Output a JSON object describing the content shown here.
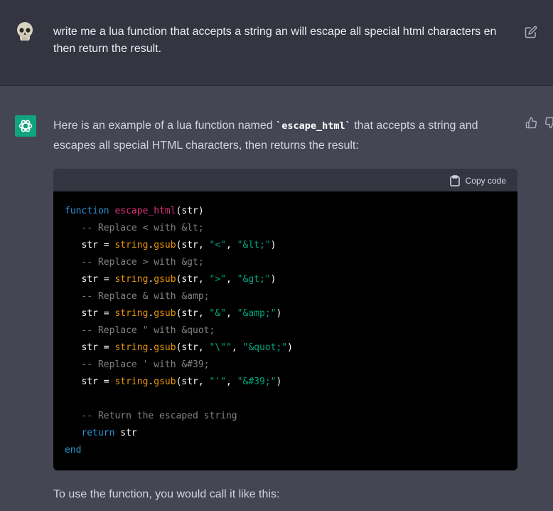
{
  "user_message": {
    "avatar_icon": "skull-icon",
    "text": "write me a lua function that accepts a string an will escape all special html characters en then return the result.",
    "edit_icon": "edit-icon"
  },
  "assistant_message": {
    "avatar_icon": "openai-logo-icon",
    "intro_before": "Here is an example of a lua function named ",
    "intro_code": "`escape_html`",
    "intro_after": " that accepts a string and escapes all special HTML characters, then returns the result:",
    "thumbs_up_icon": "thumbs-up-icon",
    "thumbs_down_icon": "thumbs-down-icon",
    "code_block": {
      "copy_label": "Copy code",
      "lines": [
        [
          {
            "t": "k",
            "v": "function"
          },
          {
            "t": "p",
            "v": " "
          },
          {
            "t": "f",
            "v": "escape_html"
          },
          {
            "t": "p",
            "v": "(str)"
          }
        ],
        [
          {
            "t": "c",
            "v": "   -- Replace < with &lt;"
          }
        ],
        [
          {
            "t": "p",
            "v": "   str = "
          },
          {
            "t": "b",
            "v": "string"
          },
          {
            "t": "p",
            "v": "."
          },
          {
            "t": "b",
            "v": "gsub"
          },
          {
            "t": "p",
            "v": "(str, "
          },
          {
            "t": "s",
            "v": "\"<\""
          },
          {
            "t": "p",
            "v": ", "
          },
          {
            "t": "s",
            "v": "\"&lt;\""
          },
          {
            "t": "p",
            "v": ")"
          }
        ],
        [
          {
            "t": "c",
            "v": "   -- Replace > with &gt;"
          }
        ],
        [
          {
            "t": "p",
            "v": "   str = "
          },
          {
            "t": "b",
            "v": "string"
          },
          {
            "t": "p",
            "v": "."
          },
          {
            "t": "b",
            "v": "gsub"
          },
          {
            "t": "p",
            "v": "(str, "
          },
          {
            "t": "s",
            "v": "\">\""
          },
          {
            "t": "p",
            "v": ", "
          },
          {
            "t": "s",
            "v": "\"&gt;\""
          },
          {
            "t": "p",
            "v": ")"
          }
        ],
        [
          {
            "t": "c",
            "v": "   -- Replace & with &amp;"
          }
        ],
        [
          {
            "t": "p",
            "v": "   str = "
          },
          {
            "t": "b",
            "v": "string"
          },
          {
            "t": "p",
            "v": "."
          },
          {
            "t": "b",
            "v": "gsub"
          },
          {
            "t": "p",
            "v": "(str, "
          },
          {
            "t": "s",
            "v": "\"&\""
          },
          {
            "t": "p",
            "v": ", "
          },
          {
            "t": "s",
            "v": "\"&amp;\""
          },
          {
            "t": "p",
            "v": ")"
          }
        ],
        [
          {
            "t": "c",
            "v": "   -- Replace \" with &quot;"
          }
        ],
        [
          {
            "t": "p",
            "v": "   str = "
          },
          {
            "t": "b",
            "v": "string"
          },
          {
            "t": "p",
            "v": "."
          },
          {
            "t": "b",
            "v": "gsub"
          },
          {
            "t": "p",
            "v": "(str, "
          },
          {
            "t": "s",
            "v": "\"\\\"\""
          },
          {
            "t": "p",
            "v": ", "
          },
          {
            "t": "s",
            "v": "\"&quot;\""
          },
          {
            "t": "p",
            "v": ")"
          }
        ],
        [
          {
            "t": "c",
            "v": "   -- Replace ' with &#39;"
          }
        ],
        [
          {
            "t": "p",
            "v": "   str = "
          },
          {
            "t": "b",
            "v": "string"
          },
          {
            "t": "p",
            "v": "."
          },
          {
            "t": "b",
            "v": "gsub"
          },
          {
            "t": "p",
            "v": "(str, "
          },
          {
            "t": "s",
            "v": "\"'\""
          },
          {
            "t": "p",
            "v": ", "
          },
          {
            "t": "s",
            "v": "\"&#39;\""
          },
          {
            "t": "p",
            "v": ")"
          }
        ],
        [
          {
            "t": "p",
            "v": ""
          }
        ],
        [
          {
            "t": "c",
            "v": "   -- Return the escaped string"
          }
        ],
        [
          {
            "t": "p",
            "v": "   "
          },
          {
            "t": "k",
            "v": "return"
          },
          {
            "t": "p",
            "v": " str"
          }
        ],
        [
          {
            "t": "k",
            "v": "end"
          }
        ]
      ]
    },
    "after_text": "To use the function, you would call it like this:"
  },
  "colors": {
    "user_bg": "#343541",
    "assistant_bg": "#444654",
    "gpt_avatar": "#10a37f",
    "keyword": "#2e95d3",
    "function_name": "#df3079",
    "builtin": "#e9950c",
    "string": "#00a67d"
  }
}
